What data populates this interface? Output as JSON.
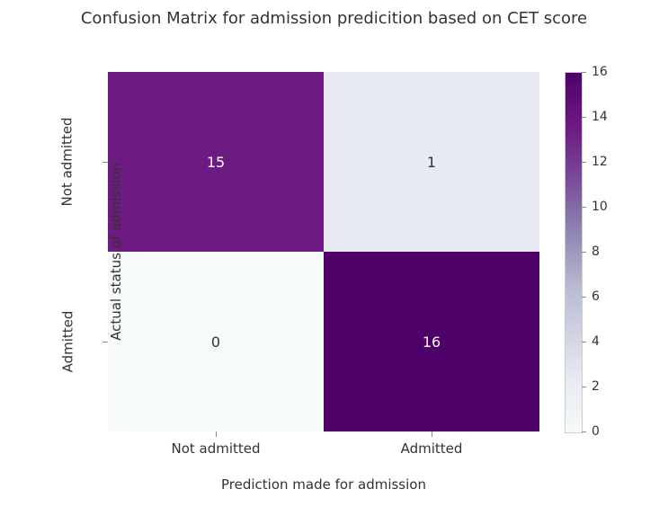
{
  "chart_data": {
    "type": "heatmap",
    "title": "Confusion Matrix for admission predicition based on CET score",
    "xlabel": "Prediction made for admission",
    "ylabel": "Actual status of admission",
    "x_categories": [
      "Not admitted",
      "Admitted"
    ],
    "y_categories": [
      "Not admitted",
      "Admitted"
    ],
    "values": [
      [
        15,
        1
      ],
      [
        0,
        16
      ]
    ],
    "colorbar_range": [
      0,
      16
    ],
    "colorbar_ticks": [
      0,
      2,
      4,
      6,
      8,
      10,
      12,
      14,
      16
    ],
    "cell_colors": [
      [
        "#6d1a82",
        "#e7eaf1"
      ],
      [
        "#f6faf9",
        "#4e0269"
      ]
    ],
    "cell_text_light": [
      [
        false,
        true
      ],
      [
        true,
        false
      ]
    ]
  }
}
